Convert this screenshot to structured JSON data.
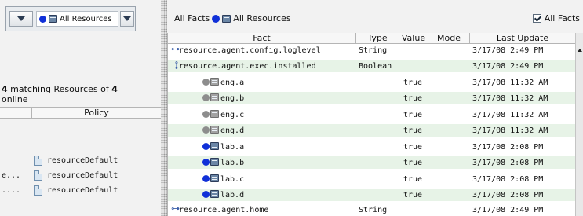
{
  "left": {
    "filter": {
      "selected": "All Resources"
    },
    "match_count": "4",
    "match_text": " matching Resources of ",
    "match_total": "4",
    "match_suffix": "online",
    "policy_header": "Policy",
    "policy_rows": [
      {
        "prefix": "",
        "name": "resourceDefault"
      },
      {
        "prefix": "e...",
        "name": "resourceDefault"
      },
      {
        "prefix": "....",
        "name": "resourceDefault"
      }
    ]
  },
  "right": {
    "title_prefix": "All Facts",
    "title_resource": "All Resources",
    "all_facts_checkbox": "All Facts",
    "columns": [
      "Fact",
      "Type",
      "Value",
      "Mode",
      "Last Update"
    ],
    "rows": [
      {
        "fact": "resource.agent.config.loglevel",
        "type": "String",
        "value": "",
        "mode": "",
        "updated": "3/17/08 2:49 PM",
        "icon": "key-icon"
      },
      {
        "fact": "resource.agent.exec.installed",
        "type": "Boolean",
        "value": "",
        "mode": "",
        "updated": "3/17/08 2:49 PM",
        "icon": "key-expanded-icon"
      },
      {
        "fact": "eng.a",
        "type": "",
        "value": "true",
        "mode": "",
        "updated": "3/17/08 11:32 AM",
        "icon": "offline-server-icon"
      },
      {
        "fact": "eng.b",
        "type": "",
        "value": "true",
        "mode": "",
        "updated": "3/17/08 11:32 AM",
        "icon": "offline-server-icon"
      },
      {
        "fact": "eng.c",
        "type": "",
        "value": "true",
        "mode": "",
        "updated": "3/17/08 11:32 AM",
        "icon": "offline-server-icon"
      },
      {
        "fact": "eng.d",
        "type": "",
        "value": "true",
        "mode": "",
        "updated": "3/17/08 11:32 AM",
        "icon": "offline-server-icon"
      },
      {
        "fact": "lab.a",
        "type": "",
        "value": "true",
        "mode": "",
        "updated": "3/17/08 2:08 PM",
        "icon": "online-server-icon"
      },
      {
        "fact": "lab.b",
        "type": "",
        "value": "true",
        "mode": "",
        "updated": "3/17/08 2:08 PM",
        "icon": "online-server-icon"
      },
      {
        "fact": "lab.c",
        "type": "",
        "value": "true",
        "mode": "",
        "updated": "3/17/08 2:08 PM",
        "icon": "online-server-icon"
      },
      {
        "fact": "lab.d",
        "type": "",
        "value": "true",
        "mode": "",
        "updated": "3/17/08 2:08 PM",
        "icon": "online-server-icon"
      },
      {
        "fact": "resource.agent.home",
        "type": "String",
        "value": "",
        "mode": "",
        "updated": "3/17/08 2:49 PM",
        "icon": "key-icon"
      }
    ]
  },
  "colors": {
    "online": "#1030d8",
    "offline": "#8d8d8d",
    "row_alt": "#e7f3e7"
  }
}
